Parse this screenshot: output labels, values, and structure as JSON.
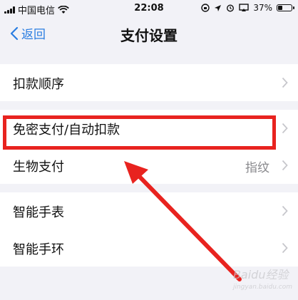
{
  "status": {
    "carrier": "中国电信",
    "time": "22:08",
    "battery_percent": "37%",
    "battery_level": 0.37
  },
  "nav": {
    "back_label": "返回",
    "title": "支付设置"
  },
  "rows": [
    {
      "label": "扣款顺序",
      "value": ""
    },
    {
      "label": "免密支付/自动扣款",
      "value": ""
    },
    {
      "label": "生物支付",
      "value": "指纹"
    },
    {
      "label": "智能手表",
      "value": ""
    },
    {
      "label": "智能手环",
      "value": ""
    }
  ],
  "watermark": {
    "text": "Baidu经验",
    "url": "jingyan.baidu.com"
  },
  "colors": {
    "accent": "#2a7de1",
    "annotation_red": "#e8231f",
    "background": "#f2f2f7"
  }
}
